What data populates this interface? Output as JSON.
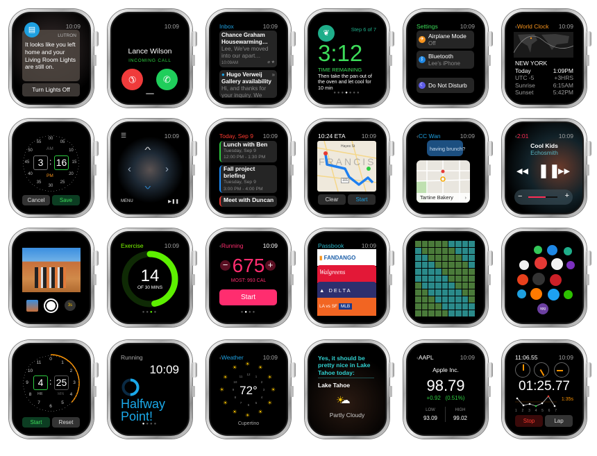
{
  "lutron": {
    "app": "LUTRON",
    "time": "10:09",
    "message": "It looks like you left home and your Living Room Lights are still on.",
    "action": "Turn Lights Off"
  },
  "call": {
    "time": "10:09",
    "caller": "Lance Wilson",
    "status": "INCOMING CALL"
  },
  "mail": {
    "title": "Inbox",
    "time": "10:09",
    "messages": [
      {
        "sender": "Chance Graham",
        "subject": "Housewarming…",
        "preview": "Lee, We've moved into our apart…",
        "time": "10:09AM"
      },
      {
        "sender": "Hugo Verweij",
        "subject": "Gallery availability",
        "preview": "Hi, and thanks for your inquiry. We"
      }
    ]
  },
  "recipe": {
    "step": "Step 6 of 7",
    "timer": "3:12",
    "label": "TIME REMAINING",
    "text": "Then take the pan out of the oven and let cool for 10 min"
  },
  "settings": {
    "title": "Settings",
    "time": "10:09",
    "items": [
      {
        "label": "Airplane Mode",
        "value": "Off",
        "color": "#f7941d"
      },
      {
        "label": "Bluetooth",
        "value": "Lee's iPhone",
        "color": "#1e88e5"
      },
      {
        "label": "Do Not Disturb",
        "color": "#5e5ce6"
      }
    ]
  },
  "worldclock": {
    "title": "World Clock",
    "time": "10:09",
    "city": "NEW YORK",
    "rows": [
      {
        "k": "Today",
        "v": "1:09PM"
      },
      {
        "k": "UTC -5",
        "v": "+3HRS"
      },
      {
        "k": "Sunrise",
        "v": "6:15AM"
      },
      {
        "k": "Sunset",
        "v": "5:42PM"
      }
    ]
  },
  "alarm": {
    "minute_labels": [
      "00",
      "05",
      "10",
      "15",
      "20",
      "25",
      "30",
      "35",
      "40",
      "45",
      "50",
      "55"
    ],
    "am": "AM",
    "pm": "PM",
    "hour": "3",
    "minute": "16",
    "cancel": "Cancel",
    "save": "Save"
  },
  "remote": {
    "time": "10:09",
    "menu": "MENU",
    "playpause": "▶❚❚"
  },
  "calendar": {
    "title": "Today, Sep 9",
    "time": "10:09",
    "events": [
      {
        "title": "Lunch with Ben",
        "date": "Tuesday, Sep 9",
        "time": "12:00 PM - 1:30 PM",
        "color": "#2ecc40"
      },
      {
        "title": "Fall project briefing",
        "date": "Tuesday, Sep 9",
        "time": "3:00 PM - 4:00 PM",
        "color": "#1e90ff"
      },
      {
        "title": "Meet with Duncan",
        "color": "#e53935"
      }
    ]
  },
  "maps": {
    "eta": "10:24 ETA",
    "time": "10:09",
    "district": "FRANCIS",
    "street": "Hayes St",
    "highway": "101",
    "clear": "Clear",
    "start": "Start"
  },
  "messages": {
    "contact": "CC Wan",
    "time": "10:09",
    "bubble": "having brunch?",
    "place": "Tartine Bakery"
  },
  "music": {
    "elapsed": "2:01",
    "time": "10:09",
    "song": "Cool Kids",
    "artist": "Echosmith",
    "volume": 0.6
  },
  "camera": {
    "timer": "3s"
  },
  "activity": {
    "title": "Exercise",
    "time": "10:09",
    "value": "14",
    "goal": "OF 30 MINS",
    "progress": 0.47
  },
  "workout": {
    "title": "Running",
    "time": "10:09",
    "value": "675",
    "most": "MOST: 993 CAL",
    "start": "Start"
  },
  "passbook": {
    "title": "Passbook",
    "time": "10:09",
    "passes": [
      {
        "name": "FANDANGO",
        "color": "#ffffff",
        "text": "#1d5fa8"
      },
      {
        "name": "Walgreens",
        "color": "#e31837",
        "text": "#ffffff"
      },
      {
        "name": "DELTA",
        "color": "#2d2f6e",
        "text": "#ffffff"
      },
      {
        "name": "LA vs SF",
        "color": "#f26522",
        "text": "#ffffff"
      }
    ]
  },
  "home": {
    "apps": [
      {
        "name": "Messages",
        "color": "#34c759"
      },
      {
        "name": "Play",
        "color": "#1e88e5"
      },
      {
        "name": "Plant",
        "color": "#1fae8a"
      },
      {
        "name": "Photos",
        "color": "#f2f2f2"
      },
      {
        "name": "Rainbow",
        "color": "#e53935"
      },
      {
        "name": "American",
        "color": "#f2f2f2"
      },
      {
        "name": "Dots",
        "color": "#7b2fbe"
      },
      {
        "name": "Nike",
        "color": "#e8401c"
      },
      {
        "name": "MLB",
        "color": "#333333"
      },
      {
        "name": "Pinterest",
        "color": "#cb2027"
      },
      {
        "name": "Lutron",
        "color": "#1ea0e0"
      },
      {
        "name": "Orange",
        "color": "#ff7a00"
      },
      {
        "name": "Twitter",
        "color": "#1da1f2"
      },
      {
        "name": "WeChat",
        "color": "#2dc100"
      },
      {
        "name": "spg",
        "color": "#6b3fa0"
      }
    ]
  },
  "timer": {
    "hour_labels": [
      "0",
      "1",
      "2",
      "3",
      "4",
      "5",
      "6",
      "7",
      "8",
      "9",
      "10",
      "11"
    ],
    "hour": "4",
    "minute": "25",
    "hr_label": "HR",
    "min_label": "MIN",
    "start": "Start",
    "reset": "Reset",
    "progress": 0.37
  },
  "running": {
    "title": "Running",
    "time": "10:09",
    "message_line1": "Halfway",
    "message_line2": "Point!",
    "progress": 0.5
  },
  "weather": {
    "title": "Weather",
    "time": "10:09",
    "temp": "72°",
    "city": "Cupertino",
    "dial_hours": [
      "12",
      "1",
      "2",
      "3",
      "4",
      "5",
      "6",
      "7",
      "8",
      "9",
      "10",
      "11"
    ]
  },
  "siri": {
    "response": "Yes, it should be pretty nice in Lake Tahoe today:",
    "location": "Lake Tahoe",
    "condition": "Partly Cloudy"
  },
  "stocks": {
    "symbol": "AAPL",
    "time": "10:09",
    "company": "Apple Inc.",
    "price": "98.79",
    "change": "+0.92",
    "percent": "(0.51%)",
    "low_label": "LOW",
    "low": "93.09",
    "high_label": "HIGH",
    "high": "99.02"
  },
  "stopwatch": {
    "clock": "11:06.55",
    "time": "10:09",
    "elapsed": "01:25.77",
    "best_lap": "1:35s",
    "laps": [
      "1",
      "2",
      "3",
      "4",
      "5",
      "6",
      "7"
    ],
    "stop": "Stop",
    "lap": "Lap"
  }
}
